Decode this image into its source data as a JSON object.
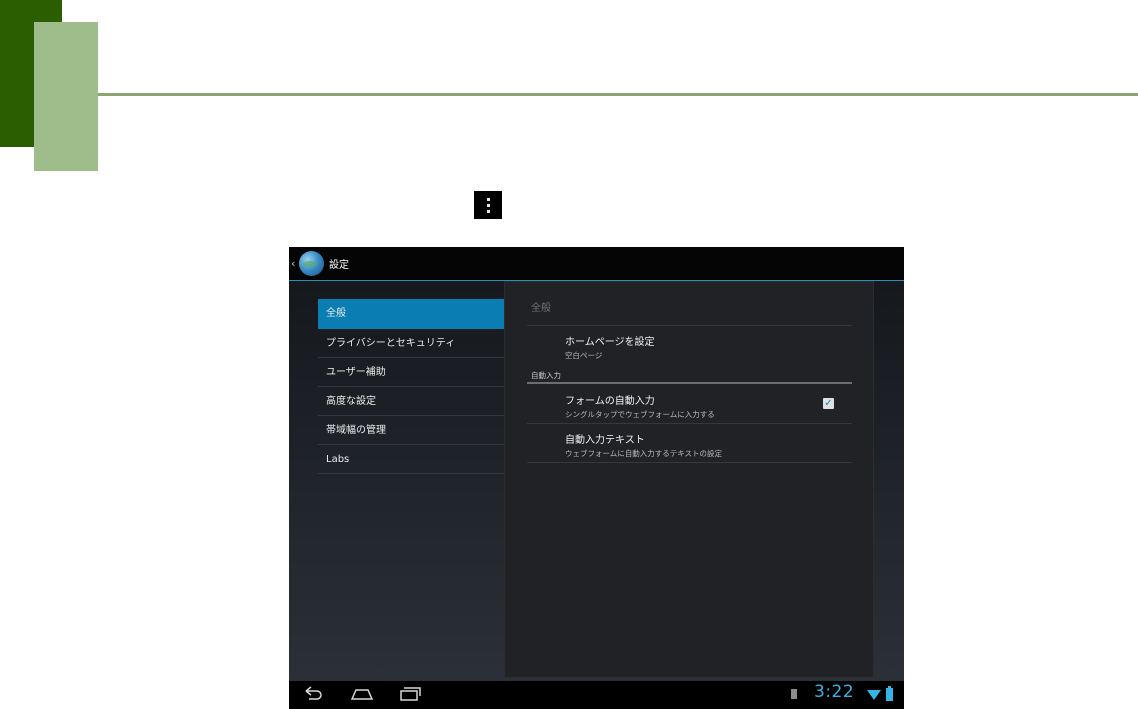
{
  "screen": {
    "action_bar": {
      "up_caret": "‹",
      "icon": "browser-globe-icon",
      "title": "設定"
    },
    "headers": [
      {
        "label": "全般",
        "selected": true
      },
      {
        "label": "プライバシーとセキュリティ",
        "selected": false
      },
      {
        "label": "ユーザー補助",
        "selected": false
      },
      {
        "label": "高度な設定",
        "selected": false
      },
      {
        "label": "帯域幅の管理",
        "selected": false
      },
      {
        "label": "Labs",
        "selected": false
      }
    ],
    "detail": {
      "title": "全般",
      "homepage": {
        "title": "ホームページを設定",
        "summary": "空白ページ"
      },
      "category": "自動入力",
      "form_autofill": {
        "title": "フォームの自動入力",
        "summary": "シングルタップでウェブフォームに入力する",
        "checked": true
      },
      "autofill_text": {
        "title": "自動入力テキスト",
        "summary": "ウェブフォームに自動入力するテキストの設定"
      }
    },
    "nav_bar": {
      "buttons": [
        "back-icon",
        "home-icon",
        "recent-apps-icon"
      ],
      "clock": "3:22",
      "status_icons": [
        "sd-card-icon",
        "wifi-icon",
        "battery-icon"
      ]
    }
  },
  "colors": {
    "accent": "#33b5e5",
    "selected_header": "#0a7db2",
    "slide_dark_green": "#2a5e00",
    "slide_light_green": "#9fbd8a",
    "slide_line": "#8aa56f"
  }
}
